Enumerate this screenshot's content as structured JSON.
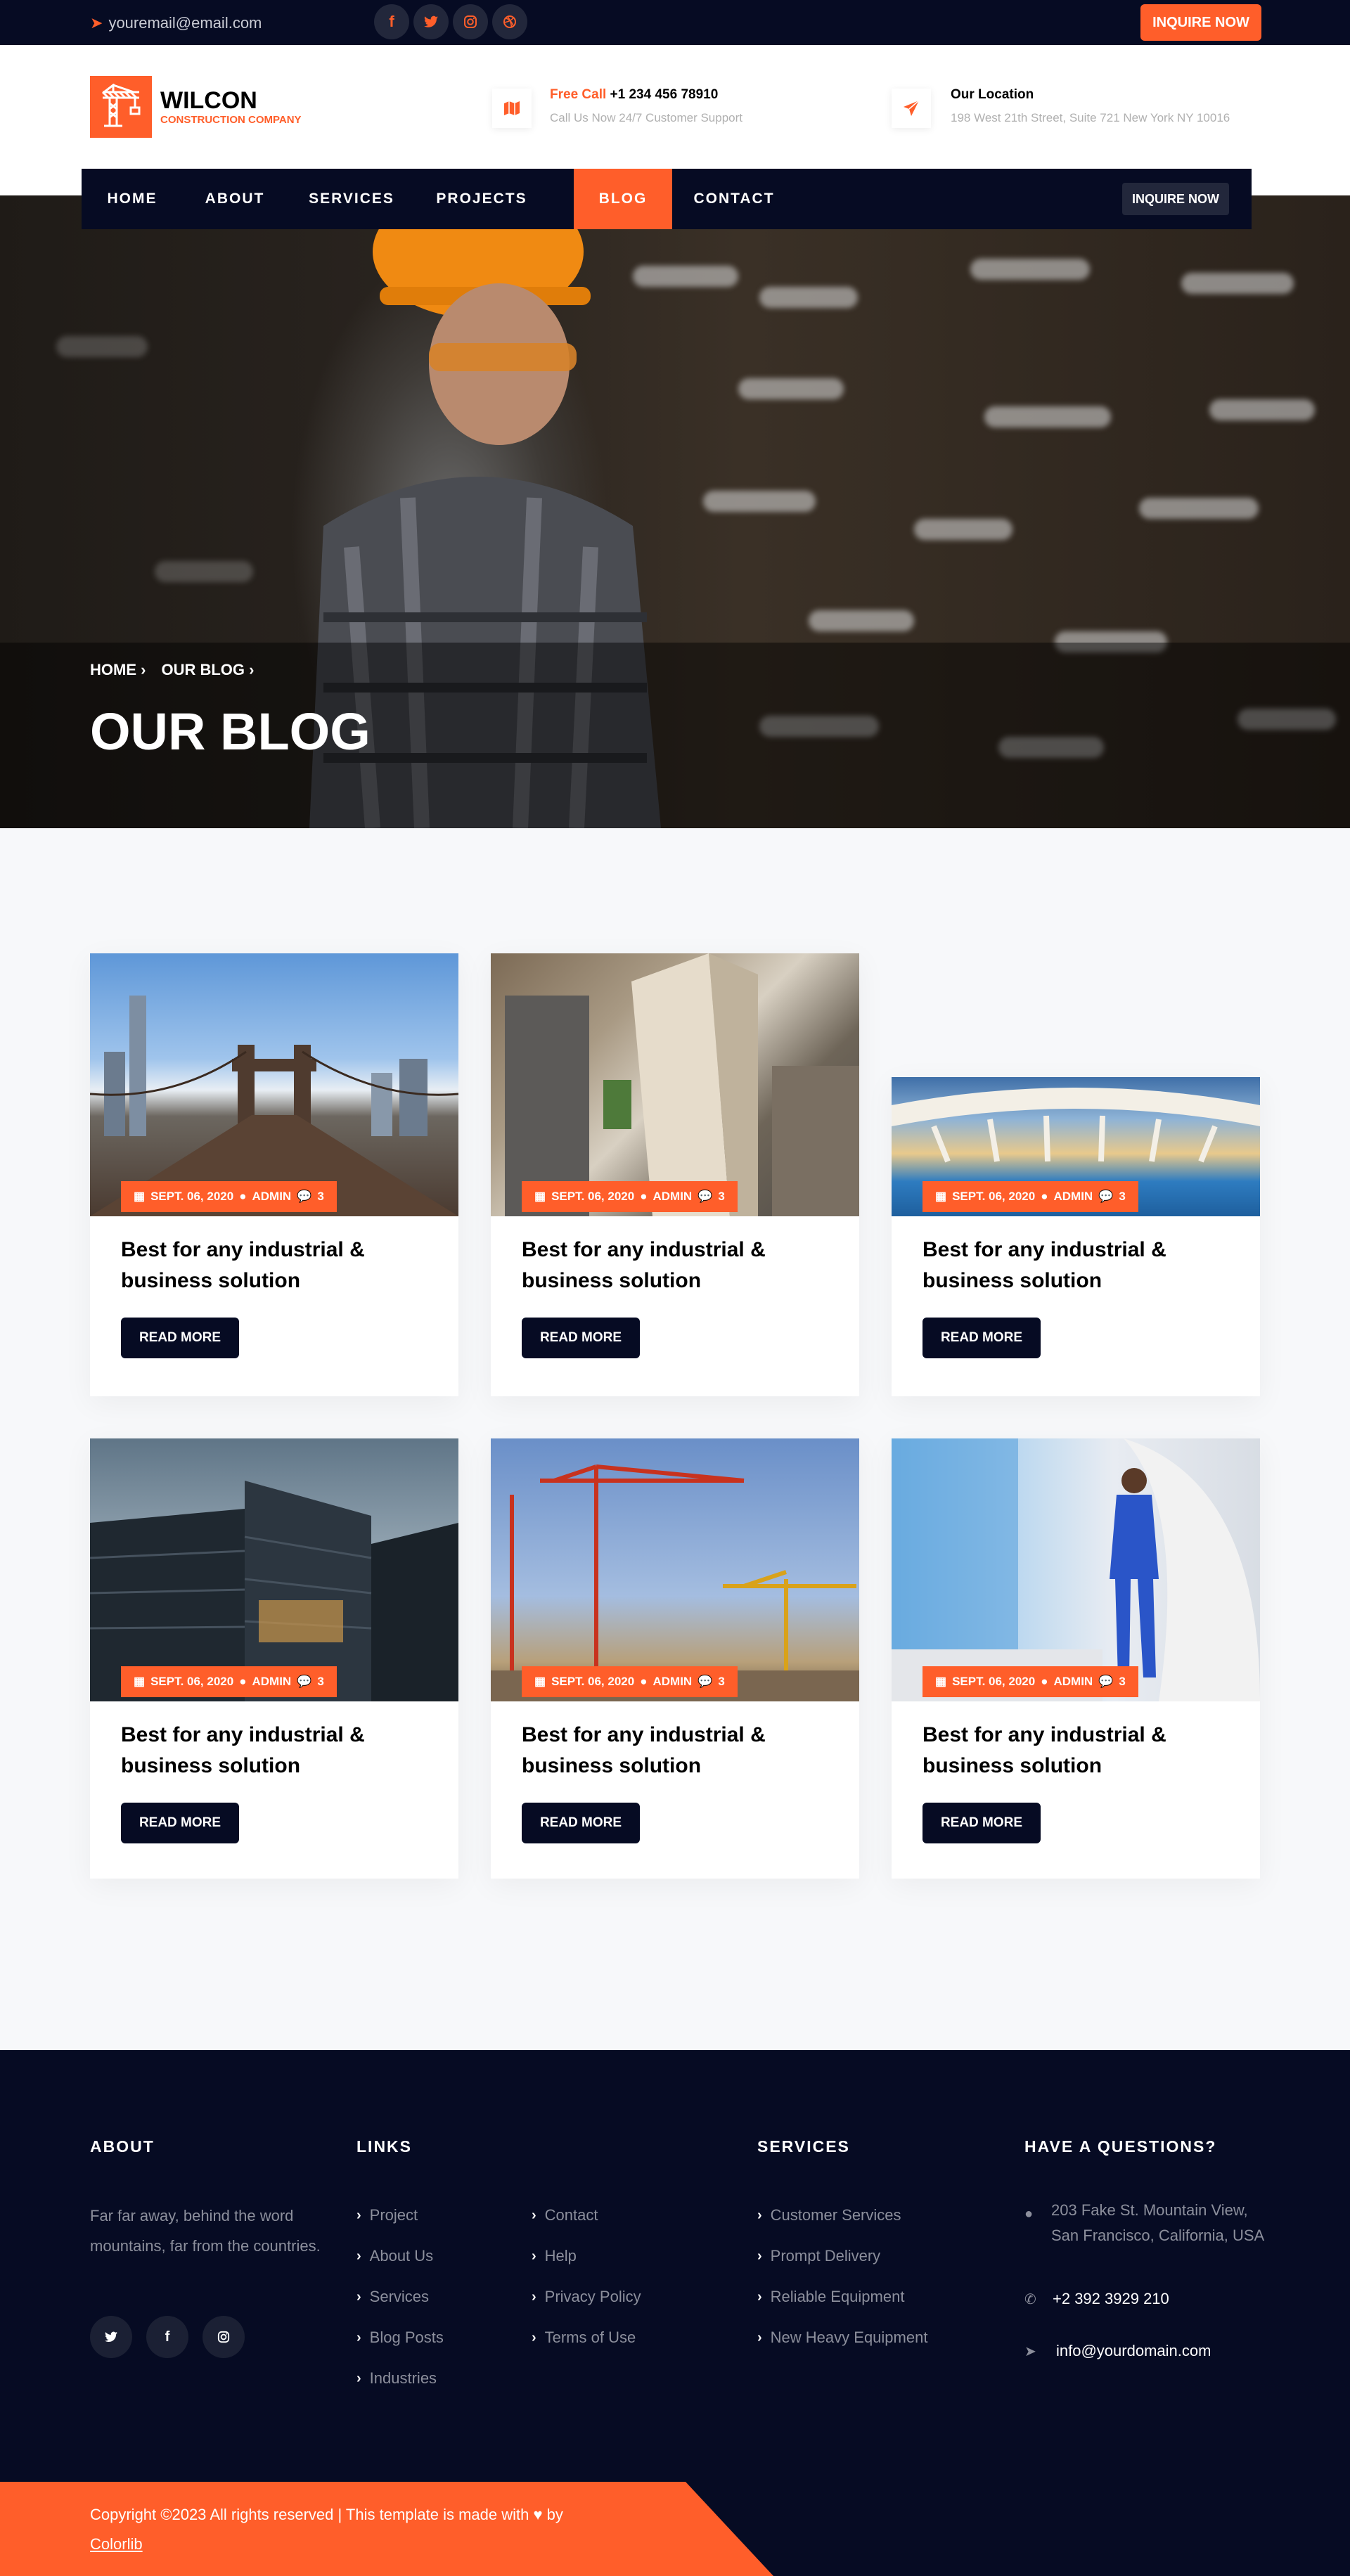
{
  "topbar": {
    "email": "youremail@email.com",
    "social": [
      "f",
      "t",
      "ig",
      "dr"
    ],
    "inquire_label": "INQUIRE NOW"
  },
  "header": {
    "logo_title": "WILCON",
    "logo_subtitle": "CONSTRUCTION COMPANY",
    "call_label": "Free Call",
    "call_number": "+1 234 456 78910",
    "call_sub": "Call Us Now 24/7 Customer Support",
    "location_label": "Our Location",
    "location_address": "198 West 21th Street, Suite 721 New York NY 10016"
  },
  "nav": {
    "items": [
      "HOME",
      "ABOUT",
      "SERVICES",
      "PROJECTS",
      "BLOG",
      "CONTACT"
    ],
    "active": "BLOG",
    "inquire_label": "INQUIRE NOW"
  },
  "hero": {
    "breadcrumb": [
      "HOME",
      "OUR BLOG"
    ],
    "title": "OUR BLOG"
  },
  "posts": [
    {
      "date": "SEPT. 06, 2020",
      "author": "ADMIN",
      "comments": "3",
      "title": "Best for any industrial & business solution",
      "button": "READ MORE"
    },
    {
      "date": "SEPT. 06, 2020",
      "author": "ADMIN",
      "comments": "3",
      "title": "Best for any industrial & business solution",
      "button": "READ MORE"
    },
    {
      "date": "SEPT. 06, 2020",
      "author": "ADMIN",
      "comments": "3",
      "title": "Best for any industrial & business solution",
      "button": "READ MORE"
    },
    {
      "date": "SEPT. 06, 2020",
      "author": "ADMIN",
      "comments": "3",
      "title": "Best for any industrial & business solution",
      "button": "READ MORE"
    },
    {
      "date": "SEPT. 06, 2020",
      "author": "ADMIN",
      "comments": "3",
      "title": "Best for any industrial & business solution",
      "button": "READ MORE"
    },
    {
      "date": "SEPT. 06, 2020",
      "author": "ADMIN",
      "comments": "3",
      "title": "Best for any industrial & business solution",
      "button": "READ MORE"
    }
  ],
  "footer": {
    "about_heading": "ABOUT",
    "about_text": "Far far away, behind the word mountains, far from the countries.",
    "links_heading": "LINKS",
    "links_col1": [
      "Project",
      "About Us",
      "Services",
      "Blog Posts",
      "Industries"
    ],
    "links_col2": [
      "Contact",
      "Help",
      "Privacy Policy",
      "Terms of Use"
    ],
    "services_heading": "SERVICES",
    "services": [
      "Customer Services",
      "Prompt Delivery",
      "Reliable Equipment",
      "New Heavy Equipment"
    ],
    "contact_heading": "HAVE A QUESTIONS?",
    "address": "203 Fake St. Mountain View, San Francisco, California, USA",
    "phone": "+2 392 3929 210",
    "email": "info@yourdomain.com",
    "copyright": "Copyright ©2023 All rights reserved | This template is made with",
    "copyright_by": "by",
    "copyright_link": "Colorlib"
  }
}
